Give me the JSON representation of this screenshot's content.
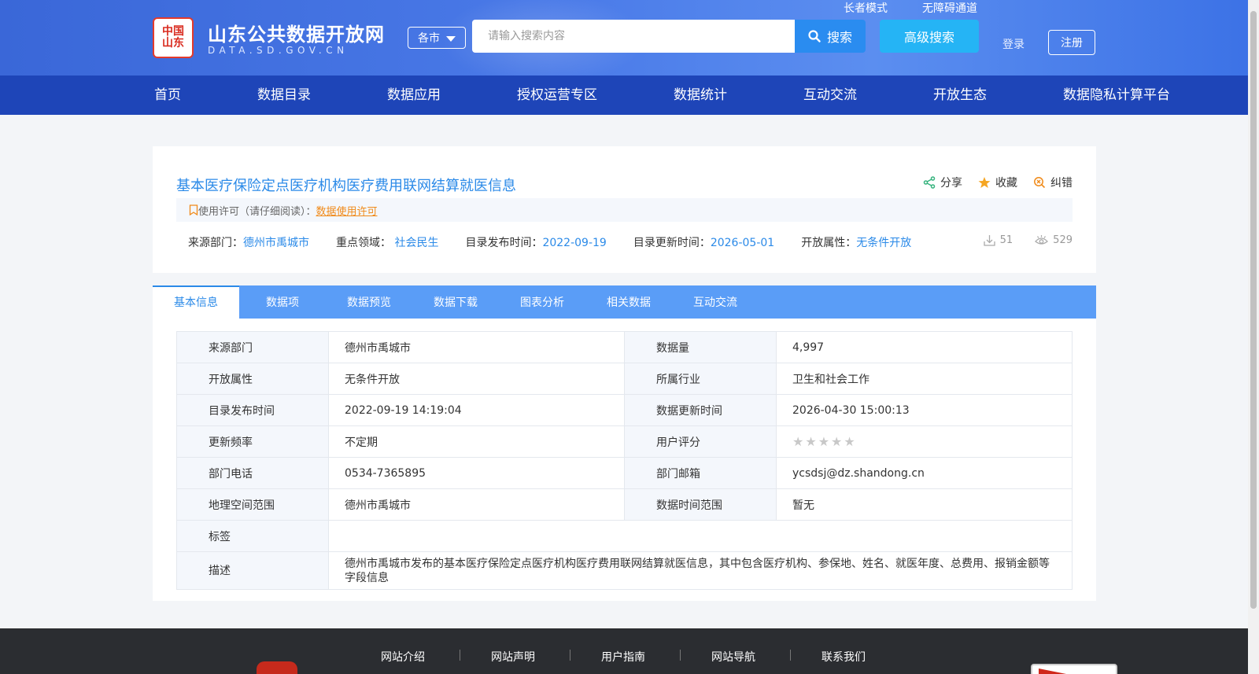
{
  "header": {
    "logo_text": "中国山东",
    "site_title": "山东公共数据开放网",
    "site_subtitle": "DATA.SD.GOV.CN",
    "city_select": "各市",
    "search_placeholder": "请输入搜索内容",
    "search_button": "搜索",
    "advanced_search": "高级搜索",
    "elder_mode": "长者模式",
    "accessibility": "无障碍通道",
    "login": "登录",
    "register": "注册"
  },
  "nav": {
    "items": [
      "首页",
      "数据目录",
      "数据应用",
      "授权运营专区",
      "数据统计",
      "互动交流",
      "开放生态",
      "数据隐私计算平台"
    ]
  },
  "dataset": {
    "title": "基本医疗保险定点医疗机构医疗费用联网结算就医信息",
    "actions": {
      "share": "分享",
      "favorite": "收藏",
      "correct": "纠错"
    },
    "license_label": "使用许可（请仔细阅读）：",
    "license_link": "数据使用许可",
    "meta": {
      "source_label": "来源部门：",
      "source_value": "德州市禹城市",
      "domain_label": "重点领域：",
      "domain_value": "社会民生",
      "publish_label": "目录发布时间：",
      "publish_value": "2022-09-19",
      "update_label": "目录更新时间：",
      "update_value": "2026-05-01",
      "open_label": "开放属性：",
      "open_value": "无条件开放"
    },
    "downloads": "51",
    "views": "529"
  },
  "tabs": [
    "基本信息",
    "数据项",
    "数据预览",
    "数据下载",
    "图表分析",
    "相关数据",
    "互动交流"
  ],
  "info": {
    "rows": [
      {
        "l1": "来源部门",
        "v1": "德州市禹城市",
        "l2": "数据量",
        "v2": "4,997"
      },
      {
        "l1": "开放属性",
        "v1": "无条件开放",
        "l2": "所属行业",
        "v2": "卫生和社会工作"
      },
      {
        "l1": "目录发布时间",
        "v1": "2022-09-19 14:19:04",
        "l2": "数据更新时间",
        "v2": "2026-04-30 15:00:13"
      },
      {
        "l1": "更新频率",
        "v1": "不定期",
        "l2": "用户评分",
        "v2": ""
      },
      {
        "l1": "部门电话",
        "v1": "0534-7365895",
        "l2": "部门邮箱",
        "v2": "ycsdsj@dz.shandong.cn"
      },
      {
        "l1": "地理空间范围",
        "v1": "德州市禹城市",
        "l2": "数据时间范围",
        "v2": "暂无"
      }
    ],
    "tags_label": "标签",
    "tags_value": "",
    "desc_label": "描述",
    "desc_value": "德州市禹城市发布的基本医疗保险定点医疗机构医疗费用联网结算就医信息，其中包含医疗机构、参保地、姓名、就医年度、总费用、报销金额等字段信息",
    "rating_stars": 0,
    "rating_max": 5
  },
  "footer": {
    "links": [
      "网站介绍",
      "网站声明",
      "用户指南",
      "网站导航",
      "联系我们"
    ]
  },
  "colors": {
    "primary": "#2b8ae8",
    "nav_bg": "#1e45b8",
    "tab_bg": "#5a9df7",
    "license_link": "#f08a19",
    "footer_bg": "#2b2d31"
  }
}
